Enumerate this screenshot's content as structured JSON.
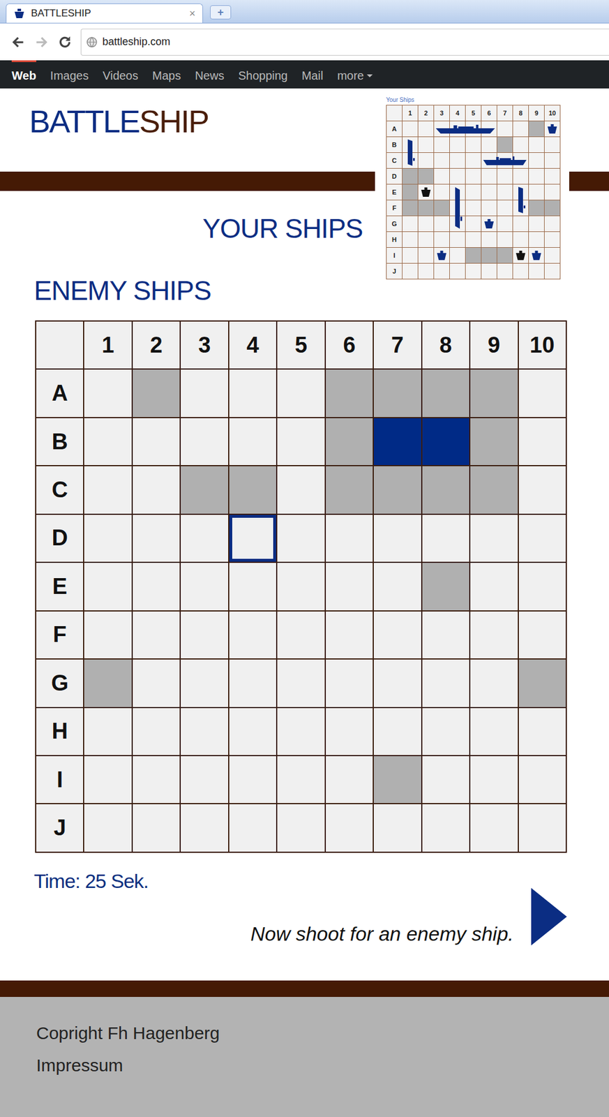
{
  "browser": {
    "tab": {
      "title": "BATTLESHIP",
      "close": "×",
      "selected": true
    },
    "new_tab": "+",
    "url": "battleship.com"
  },
  "nav": [
    {
      "label": "Web",
      "selected": true,
      "dropdown": false
    },
    {
      "label": "Images",
      "selected": false,
      "dropdown": false
    },
    {
      "label": "Videos",
      "selected": false,
      "dropdown": false
    },
    {
      "label": "Maps",
      "selected": false,
      "dropdown": false
    },
    {
      "label": "News",
      "selected": false,
      "dropdown": false
    },
    {
      "label": "Shopping",
      "selected": false,
      "dropdown": false
    },
    {
      "label": "Mail",
      "selected": false,
      "dropdown": false
    },
    {
      "label": "more",
      "selected": false,
      "dropdown": true
    }
  ],
  "logo": {
    "first": "BATTLE",
    "second": "SHIP"
  },
  "your_ships": {
    "heading": "YOUR SHIPS",
    "caption": "Your Ships",
    "columns": [
      "1",
      "2",
      "3",
      "4",
      "5",
      "6",
      "7",
      "8",
      "9",
      "10"
    ],
    "rows": [
      {
        "label": "A",
        "cells": [
          "empty",
          "empty",
          "empty",
          "empty",
          "empty",
          "empty",
          "empty",
          "empty",
          "miss",
          "empty"
        ]
      },
      {
        "label": "B",
        "cells": [
          "empty",
          "empty",
          "empty",
          "empty",
          "empty",
          "empty",
          "miss",
          "empty",
          "empty",
          "empty"
        ]
      },
      {
        "label": "C",
        "cells": [
          "empty",
          "empty",
          "empty",
          "empty",
          "empty",
          "empty",
          "empty",
          "empty",
          "empty",
          "empty"
        ]
      },
      {
        "label": "D",
        "cells": [
          "miss",
          "miss",
          "empty",
          "empty",
          "empty",
          "empty",
          "empty",
          "empty",
          "empty",
          "empty"
        ]
      },
      {
        "label": "E",
        "cells": [
          "miss",
          "empty",
          "empty",
          "empty",
          "empty",
          "empty",
          "empty",
          "empty",
          "empty",
          "empty"
        ]
      },
      {
        "label": "F",
        "cells": [
          "miss",
          "miss",
          "miss",
          "empty",
          "empty",
          "empty",
          "empty",
          "empty",
          "miss",
          "miss"
        ]
      },
      {
        "label": "G",
        "cells": [
          "empty",
          "empty",
          "empty",
          "empty",
          "empty",
          "empty",
          "empty",
          "empty",
          "empty",
          "empty"
        ]
      },
      {
        "label": "H",
        "cells": [
          "empty",
          "empty",
          "empty",
          "empty",
          "empty",
          "empty",
          "empty",
          "empty",
          "empty",
          "empty"
        ]
      },
      {
        "label": "I",
        "cells": [
          "empty",
          "empty",
          "empty",
          "empty",
          "miss",
          "miss",
          "miss",
          "empty",
          "empty",
          "empty"
        ]
      },
      {
        "label": "J",
        "cells": [
          "empty",
          "empty",
          "empty",
          "empty",
          "empty",
          "empty",
          "empty",
          "empty",
          "empty",
          "empty"
        ]
      }
    ],
    "ships": [
      {
        "row": "A",
        "col": "3",
        "length": 4,
        "orientation": "horizontal",
        "hit": false
      },
      {
        "row": "A",
        "col": "10",
        "length": 1,
        "orientation": "horizontal",
        "hit": false
      },
      {
        "row": "B",
        "col": "1",
        "length": 2,
        "orientation": "vertical",
        "hit": false
      },
      {
        "row": "C",
        "col": "6",
        "length": 3,
        "orientation": "horizontal",
        "hit": false
      },
      {
        "row": "E",
        "col": "2",
        "length": 1,
        "orientation": "horizontal",
        "hit": true
      },
      {
        "row": "E",
        "col": "4",
        "length": 3,
        "orientation": "vertical",
        "hit": false
      },
      {
        "row": "E",
        "col": "8",
        "length": 2,
        "orientation": "vertical",
        "hit": false
      },
      {
        "row": "G",
        "col": "6",
        "length": 1,
        "orientation": "horizontal",
        "hit": false
      },
      {
        "row": "I",
        "col": "3",
        "length": 1,
        "orientation": "horizontal",
        "hit": false
      },
      {
        "row": "I",
        "col": "8",
        "length": 1,
        "orientation": "horizontal",
        "hit": true
      },
      {
        "row": "I",
        "col": "9",
        "length": 1,
        "orientation": "horizontal",
        "hit": false
      }
    ]
  },
  "enemy_ships": {
    "heading": "ENEMY SHIPS",
    "columns": [
      "1",
      "2",
      "3",
      "4",
      "5",
      "6",
      "7",
      "8",
      "9",
      "10"
    ],
    "rows": [
      {
        "label": "A",
        "cells": [
          {
            "state": "empty",
            "selected": false
          },
          {
            "state": "miss",
            "selected": false
          },
          {
            "state": "empty",
            "selected": false
          },
          {
            "state": "empty",
            "selected": false
          },
          {
            "state": "empty",
            "selected": false
          },
          {
            "state": "miss",
            "selected": false
          },
          {
            "state": "miss",
            "selected": false
          },
          {
            "state": "miss",
            "selected": false
          },
          {
            "state": "miss",
            "selected": false
          },
          {
            "state": "empty",
            "selected": false
          }
        ]
      },
      {
        "label": "B",
        "cells": [
          {
            "state": "empty",
            "selected": false
          },
          {
            "state": "empty",
            "selected": false
          },
          {
            "state": "empty",
            "selected": false
          },
          {
            "state": "empty",
            "selected": false
          },
          {
            "state": "empty",
            "selected": false
          },
          {
            "state": "miss",
            "selected": false
          },
          {
            "state": "hit",
            "selected": false
          },
          {
            "state": "hit",
            "selected": false
          },
          {
            "state": "miss",
            "selected": false
          },
          {
            "state": "empty",
            "selected": false
          }
        ]
      },
      {
        "label": "C",
        "cells": [
          {
            "state": "empty",
            "selected": false
          },
          {
            "state": "empty",
            "selected": false
          },
          {
            "state": "miss",
            "selected": false
          },
          {
            "state": "miss",
            "selected": false
          },
          {
            "state": "empty",
            "selected": false
          },
          {
            "state": "miss",
            "selected": false
          },
          {
            "state": "miss",
            "selected": false
          },
          {
            "state": "miss",
            "selected": false
          },
          {
            "state": "miss",
            "selected": false
          },
          {
            "state": "empty",
            "selected": false
          }
        ]
      },
      {
        "label": "D",
        "cells": [
          {
            "state": "empty",
            "selected": false
          },
          {
            "state": "empty",
            "selected": false
          },
          {
            "state": "empty",
            "selected": false
          },
          {
            "state": "empty",
            "selected": true
          },
          {
            "state": "empty",
            "selected": false
          },
          {
            "state": "empty",
            "selected": false
          },
          {
            "state": "empty",
            "selected": false
          },
          {
            "state": "empty",
            "selected": false
          },
          {
            "state": "empty",
            "selected": false
          },
          {
            "state": "empty",
            "selected": false
          }
        ]
      },
      {
        "label": "E",
        "cells": [
          {
            "state": "empty",
            "selected": false
          },
          {
            "state": "empty",
            "selected": false
          },
          {
            "state": "empty",
            "selected": false
          },
          {
            "state": "empty",
            "selected": false
          },
          {
            "state": "empty",
            "selected": false
          },
          {
            "state": "empty",
            "selected": false
          },
          {
            "state": "empty",
            "selected": false
          },
          {
            "state": "miss",
            "selected": false
          },
          {
            "state": "empty",
            "selected": false
          },
          {
            "state": "empty",
            "selected": false
          }
        ]
      },
      {
        "label": "F",
        "cells": [
          {
            "state": "empty",
            "selected": false
          },
          {
            "state": "empty",
            "selected": false
          },
          {
            "state": "empty",
            "selected": false
          },
          {
            "state": "empty",
            "selected": false
          },
          {
            "state": "empty",
            "selected": false
          },
          {
            "state": "empty",
            "selected": false
          },
          {
            "state": "empty",
            "selected": false
          },
          {
            "state": "empty",
            "selected": false
          },
          {
            "state": "empty",
            "selected": false
          },
          {
            "state": "empty",
            "selected": false
          }
        ]
      },
      {
        "label": "G",
        "cells": [
          {
            "state": "miss",
            "selected": false
          },
          {
            "state": "empty",
            "selected": false
          },
          {
            "state": "empty",
            "selected": false
          },
          {
            "state": "empty",
            "selected": false
          },
          {
            "state": "empty",
            "selected": false
          },
          {
            "state": "empty",
            "selected": false
          },
          {
            "state": "empty",
            "selected": false
          },
          {
            "state": "empty",
            "selected": false
          },
          {
            "state": "empty",
            "selected": false
          },
          {
            "state": "miss",
            "selected": false
          }
        ]
      },
      {
        "label": "H",
        "cells": [
          {
            "state": "empty",
            "selected": false
          },
          {
            "state": "empty",
            "selected": false
          },
          {
            "state": "empty",
            "selected": false
          },
          {
            "state": "empty",
            "selected": false
          },
          {
            "state": "empty",
            "selected": false
          },
          {
            "state": "empty",
            "selected": false
          },
          {
            "state": "empty",
            "selected": false
          },
          {
            "state": "empty",
            "selected": false
          },
          {
            "state": "empty",
            "selected": false
          },
          {
            "state": "empty",
            "selected": false
          }
        ]
      },
      {
        "label": "I",
        "cells": [
          {
            "state": "empty",
            "selected": false
          },
          {
            "state": "empty",
            "selected": false
          },
          {
            "state": "empty",
            "selected": false
          },
          {
            "state": "empty",
            "selected": false
          },
          {
            "state": "empty",
            "selected": false
          },
          {
            "state": "empty",
            "selected": false
          },
          {
            "state": "miss",
            "selected": false
          },
          {
            "state": "empty",
            "selected": false
          },
          {
            "state": "empty",
            "selected": false
          },
          {
            "state": "empty",
            "selected": false
          }
        ]
      },
      {
        "label": "J",
        "cells": [
          {
            "state": "empty",
            "selected": false
          },
          {
            "state": "empty",
            "selected": false
          },
          {
            "state": "empty",
            "selected": false
          },
          {
            "state": "empty",
            "selected": false
          },
          {
            "state": "empty",
            "selected": false
          },
          {
            "state": "empty",
            "selected": false
          },
          {
            "state": "empty",
            "selected": false
          },
          {
            "state": "empty",
            "selected": false
          },
          {
            "state": "empty",
            "selected": false
          },
          {
            "state": "empty",
            "selected": false
          }
        ]
      }
    ]
  },
  "timer": "Time: 25 Sek.",
  "prompt": "Now shoot for an enemy ship.",
  "footer": [
    "Copright Fh Hagenberg",
    "Impressum"
  ]
}
